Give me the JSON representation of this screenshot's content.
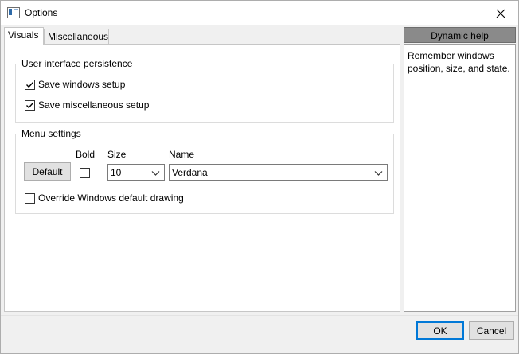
{
  "window": {
    "title": "Options",
    "icon": "app-window-icon",
    "close_icon": "close-icon"
  },
  "tabs": [
    {
      "label": "Visuals",
      "active": true
    },
    {
      "label": "Miscellaneous",
      "active": false
    }
  ],
  "persistence": {
    "title": "User interface persistence",
    "save_windows": {
      "label": "Save windows setup",
      "checked": true
    },
    "save_misc": {
      "label": "Save miscellaneous setup",
      "checked": true
    }
  },
  "menu_settings": {
    "title": "Menu settings",
    "bold_label": "Bold",
    "size_label": "Size",
    "name_label": "Name",
    "default_button": "Default",
    "bold_checked": false,
    "size_value": "10",
    "name_value": "Verdana",
    "override": {
      "label": "Override Windows default drawing",
      "checked": false
    }
  },
  "help": {
    "title": "Dynamic help",
    "text": "Remember windows position, size, and state."
  },
  "footer": {
    "ok": "OK",
    "cancel": "Cancel"
  },
  "colors": {
    "accent": "#0078d7",
    "help_header": "#8a8a8a"
  }
}
